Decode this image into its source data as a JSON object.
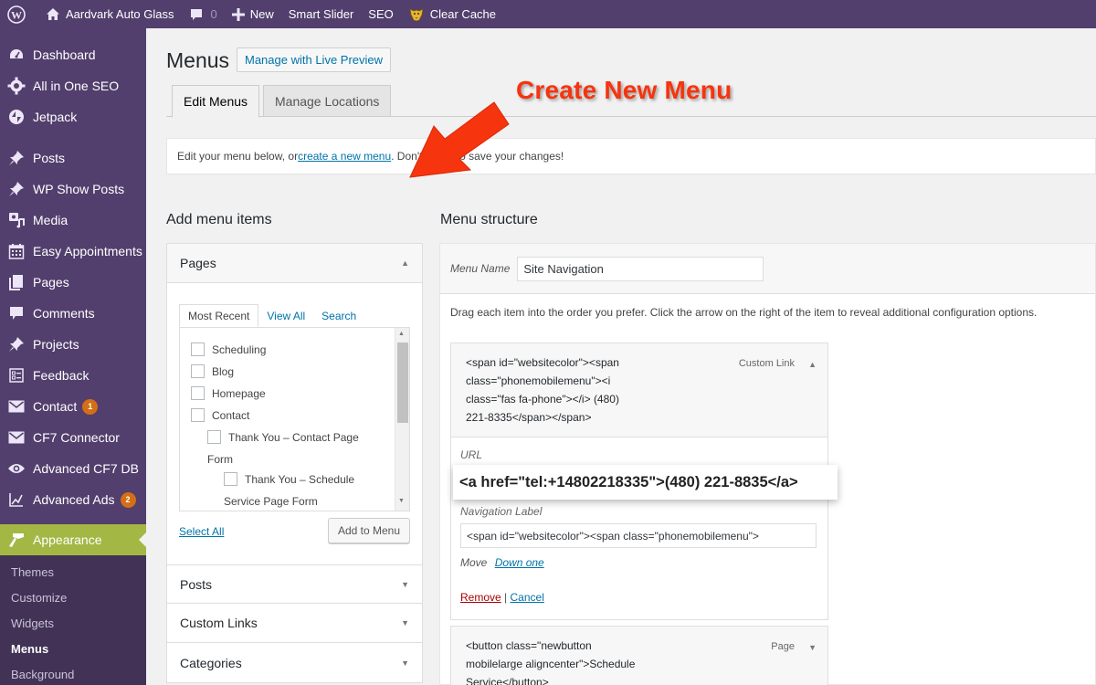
{
  "adminbar": {
    "site_name": "Aardvark Auto Glass",
    "comments_count": "0",
    "new_label": "New",
    "smart_slider": "Smart Slider",
    "seo": "SEO",
    "clear_cache": "Clear Cache"
  },
  "sidebar": {
    "items": [
      {
        "label": "Dashboard",
        "icon": "dashboard-icon"
      },
      {
        "label": "All in One SEO",
        "icon": "gear-icon"
      },
      {
        "label": "Jetpack",
        "icon": "jetpack-icon"
      },
      {
        "label": "Posts",
        "icon": "pin-icon"
      },
      {
        "label": "WP Show Posts",
        "icon": "pin-icon"
      },
      {
        "label": "Media",
        "icon": "media-icon"
      },
      {
        "label": "Easy Appointments",
        "icon": "calendar-icon"
      },
      {
        "label": "Pages",
        "icon": "pages-icon"
      },
      {
        "label": "Comments",
        "icon": "comment-icon"
      },
      {
        "label": "Projects",
        "icon": "pin-icon"
      },
      {
        "label": "Feedback",
        "icon": "feedback-icon"
      },
      {
        "label": "Contact",
        "icon": "mail-icon",
        "badge": "1"
      },
      {
        "label": "CF7 Connector",
        "icon": "mail-icon"
      },
      {
        "label": "Advanced CF7 DB",
        "icon": "eye-icon"
      },
      {
        "label": "Advanced Ads",
        "icon": "chart-icon",
        "badge": "2"
      },
      {
        "label": "Appearance",
        "icon": "brush-icon"
      }
    ],
    "submenu": [
      "Themes",
      "Customize",
      "Widgets",
      "Menus",
      "Background"
    ],
    "current_sub": "Menus"
  },
  "page": {
    "title": "Menus",
    "live_preview_button": "Manage with Live Preview",
    "tabs": [
      "Edit Menus",
      "Manage Locations"
    ],
    "notice_prefix": "Edit your menu below, or ",
    "notice_link": "create a new menu",
    "notice_suffix": ". Don't forget to save your changes!",
    "callout": "Create New Menu",
    "callout_color": "#f6340e"
  },
  "add_items": {
    "title": "Add menu items",
    "pages_label": "Pages",
    "inner_tabs": [
      "Most Recent",
      "View All",
      "Search"
    ],
    "pages": [
      "Scheduling",
      "Blog",
      "Homepage",
      "Contact"
    ],
    "child_page_line1": "Thank You – Contact Page",
    "child_page_line2": "Form",
    "grandchild_line1": "Thank You – Schedule",
    "grandchild_line2": "Service Page Form",
    "select_all": "Select All",
    "add_to_menu": "Add to Menu",
    "sections": [
      "Posts",
      "Custom Links",
      "Categories"
    ]
  },
  "structure": {
    "title": "Menu structure",
    "menu_name_label": "Menu Name",
    "menu_name_value": "Site Navigation",
    "drag_hint": "Drag each item into the order you prefer. Click the arrow on the right of the item to reveal additional configuration options.",
    "item1": {
      "title_lines": [
        "<span id=\"websitecolor\"><span",
        "class=\"phonemobilemenu\"><i",
        "class=\"fas fa-phone\"></i> (480)",
        "221-8335</span></span>"
      ],
      "type": "Custom Link",
      "url_label": "URL",
      "nav_label": "Navigation Label",
      "nav_value": "<span id=\"websitecolor\"><span class=\"phonemobilemenu\">",
      "move_label": "Move",
      "move_link": "Down one",
      "remove": "Remove",
      "separator": "|",
      "cancel": "Cancel"
    },
    "url_callout": "<a href=\"tel:+14802218335\">(480) 221-8835</a>",
    "item2": {
      "title_lines": [
        "<button class=\"newbutton",
        "mobilelarge aligncenter\">Schedule",
        "Service</button>"
      ],
      "type": "Page"
    }
  }
}
